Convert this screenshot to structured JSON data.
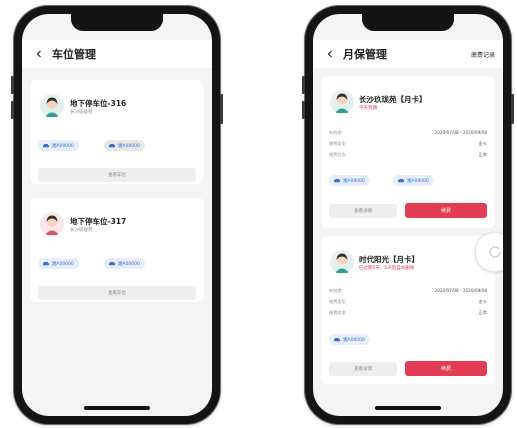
{
  "left_screen": {
    "title": "车位管理",
    "cards": [
      {
        "name": "地下停车位-316",
        "sub": "长沙玖珑苑",
        "plates": [
          "湘A00000",
          "湘A00000"
        ],
        "action": "查看车位"
      },
      {
        "name": "地下停车位-317",
        "sub": "长沙玖珑苑",
        "plates": [
          "湘A00000",
          "湘A00000"
        ],
        "action": "查看车位"
      }
    ]
  },
  "right_screen": {
    "title": "月保管理",
    "header_action": "缴费记录",
    "cards": [
      {
        "name": "长沙玖珑苑【月卡】",
        "sub": "今天到期",
        "rows": [
          {
            "label": "有效期",
            "value": "2020/07/08 - 2020/09/08"
          },
          {
            "label": "缴费类型",
            "value": "金卡"
          },
          {
            "label": "缴费状态",
            "value": "正常"
          }
        ],
        "plates": [
          "湘A00000",
          "湘A00000"
        ],
        "secondary": "查看详情",
        "primary": "续费"
      },
      {
        "name": "时代阳光【月卡】",
        "sub": "已过期5天，5天后自动删除",
        "rows": [
          {
            "label": "有效期",
            "value": "2020/07/08 - 2020/09/08"
          },
          {
            "label": "缴费类型",
            "value": "金卡"
          },
          {
            "label": "缴费状态",
            "value": "正常"
          }
        ],
        "plates": [
          "湘A00000"
        ],
        "secondary": "查看详情",
        "primary": "续费"
      }
    ]
  },
  "colors": {
    "accent_red": "#e23d52",
    "plate_blue": "#3b6fd4",
    "plate_bg": "#e6eefb",
    "page_bg": "#f4f4f4"
  },
  "icons": [
    "back-chevron-icon",
    "user-avatar-icon",
    "car-icon"
  ]
}
